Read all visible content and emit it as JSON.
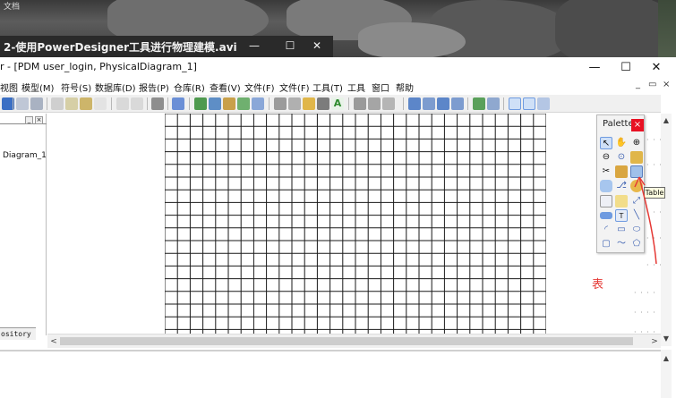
{
  "desktop": {
    "caption": "文档"
  },
  "video": {
    "title": "2-使用PowerDesigner工具进行物理建模.avi",
    "minimize": "—",
    "maximize": "☐",
    "close": "✕"
  },
  "app": {
    "title": "r - [PDM user_login, PhysicalDiagram_1]",
    "minimize": "—",
    "maximize": "☐",
    "close": "✕"
  },
  "menubar": {
    "items": [
      "视图",
      "模型(M)",
      "符号(S)",
      "数据库(D)",
      "报告(P)",
      "仓库(R)",
      "查看(V)",
      "文件(F)",
      "文件(F)",
      "工具(T)",
      "工具",
      "窗口",
      "帮助"
    ],
    "mdi_minimize": "_",
    "mdi_restore": "▭",
    "mdi_close": "×"
  },
  "browser": {
    "item": "Diagram_1",
    "tab": "ository"
  },
  "palette": {
    "title": "Palette",
    "close": "×",
    "tooltip": "Table"
  },
  "annotation": {
    "text": "表",
    "color": "#e53935"
  },
  "colors": {
    "accent_red": "#e81123",
    "grid_line": "#1a1a1a",
    "toolbar_bg": "#f0f0f0"
  }
}
